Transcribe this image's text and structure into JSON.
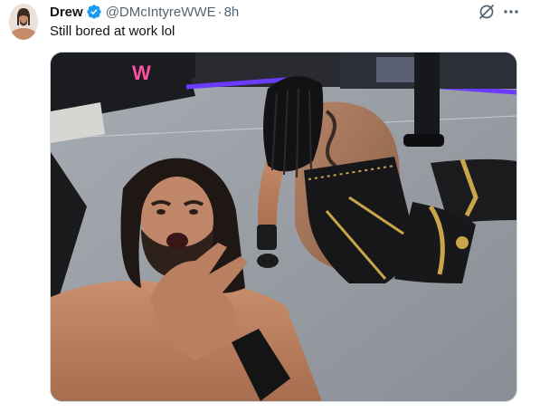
{
  "tweet": {
    "author": {
      "display_name": "Drew",
      "handle": "@DMcIntyreWWE",
      "verified": true,
      "verified_color": "#1d9bf0",
      "avatar_icon": "user-avatar"
    },
    "separator": "·",
    "timestamp": "8h",
    "text": "Still bored at work lol",
    "actions": {
      "grok_icon": "grok-icon",
      "more_icon": "more-icon"
    },
    "media": {
      "type": "photo",
      "arena_logo_text": "W"
    }
  },
  "colors": {
    "text_primary": "#0f1419",
    "text_secondary": "#536471",
    "border": "#cfd9de",
    "ring_mat": "#8d9299",
    "arena_light": "#6b3cff"
  }
}
